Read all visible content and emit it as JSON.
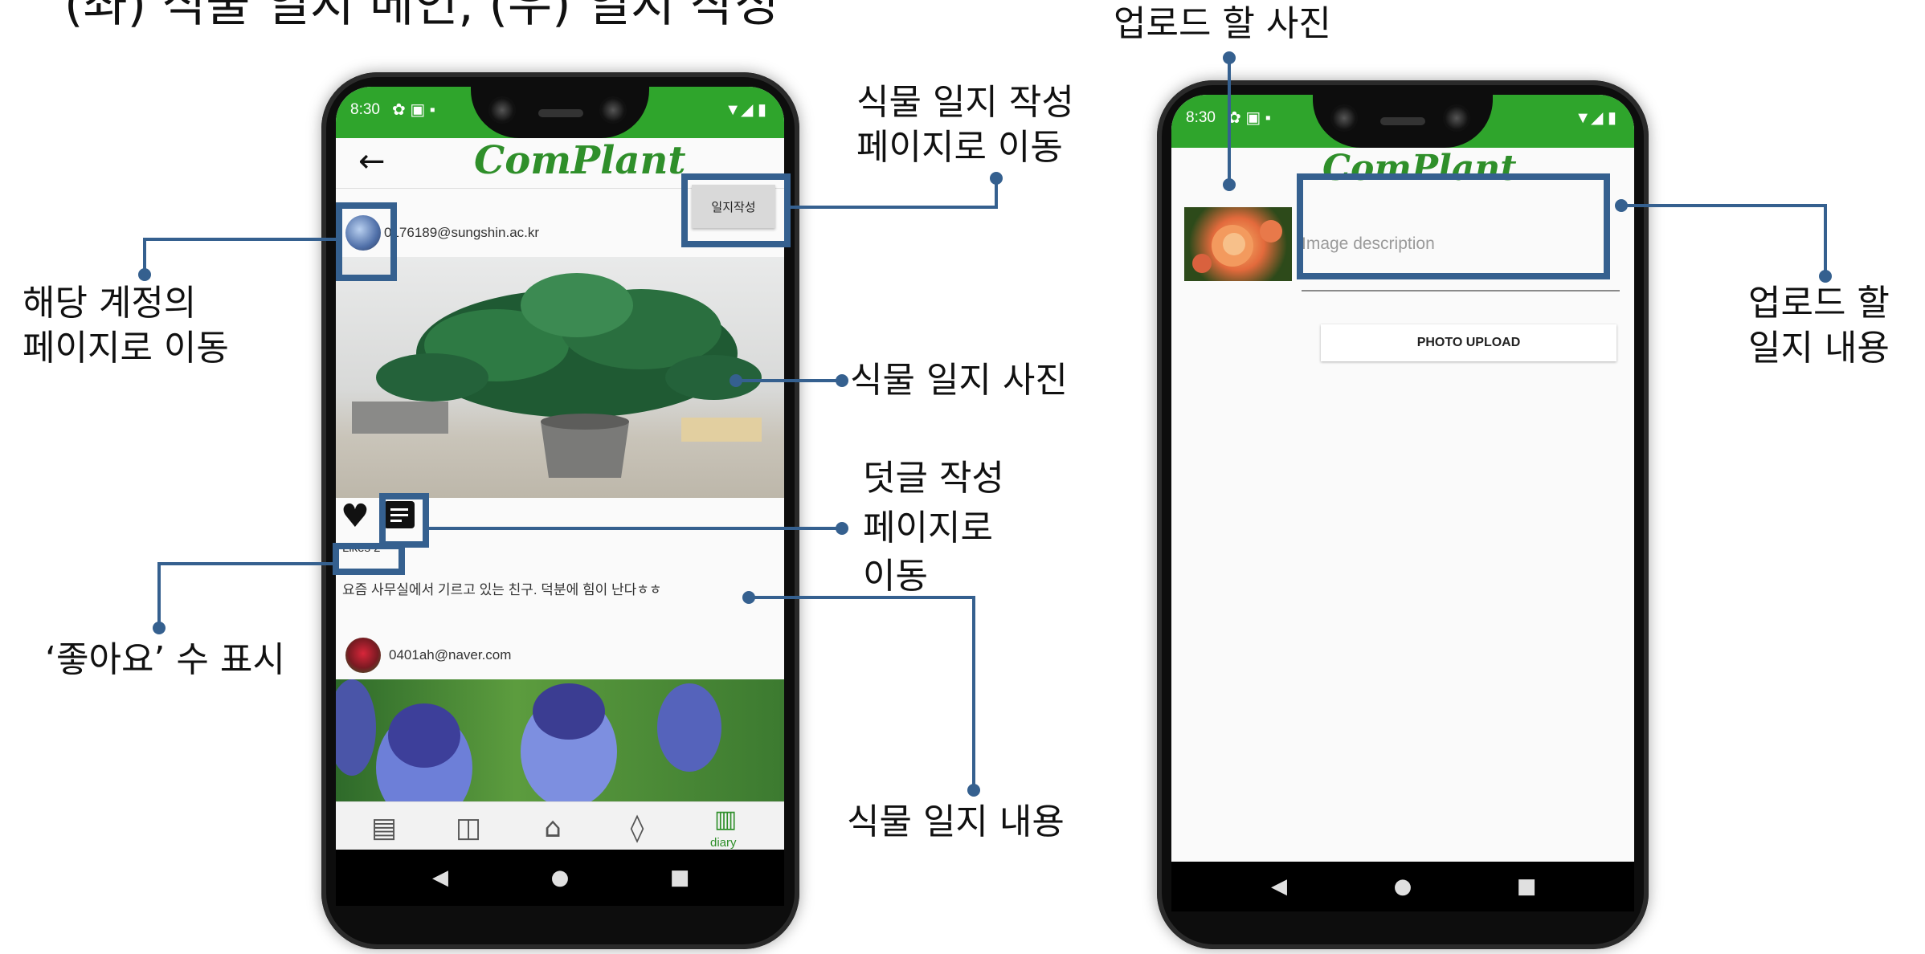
{
  "page": {
    "heading": "(좌) 식물 일지 메인, (우) 일지 작성"
  },
  "left_phone": {
    "status_time": "8:30",
    "status_icons": "✿ ▣ ▪",
    "status_right": "▼◢ ▮",
    "back_icon_glyph": "←",
    "logo_text": "ComPlant",
    "write_button_label": "일지작성",
    "post1": {
      "user_email": "0176189@sungshin.ac.kr",
      "likes_text": "Likes 2",
      "content_text": "요즘 사무실에서 기르고 있는 친구. 덕분에 힘이 난다ㅎㅎ"
    },
    "post2": {
      "user_email": "0401ah@naver.com"
    },
    "bottom_nav": {
      "diary_label": "diary"
    }
  },
  "right_phone": {
    "status_time": "8:30",
    "status_icons": "✿ ▣ ▪",
    "status_right": "▼◢ ▮",
    "logo_text": "ComPlant",
    "description_placeholder": "Image description",
    "upload_button_label": "PHOTO UPLOAD"
  },
  "callouts": {
    "move_to_write_l1": "식물 일지 작성",
    "move_to_write_l2": "페이지로 이동",
    "account_page_l1": "해당 계정의",
    "account_page_l2": "페이지로 이동",
    "diary_photo": "식물 일지 사진",
    "comment_l1": "덧글 작성",
    "comment_l2": "페이지로",
    "comment_l3": "이동",
    "likes_count": "‘좋아요’ 수 표시",
    "diary_content": "식물 일지 내용",
    "upload_photo": "업로드 할 사진",
    "upload_content_l1": "업로드 할",
    "upload_content_l2": "일지 내용"
  },
  "colors": {
    "status_green": "#2fa52c",
    "callout_blue": "#35608f",
    "logo_green": "#2f8f2a"
  }
}
